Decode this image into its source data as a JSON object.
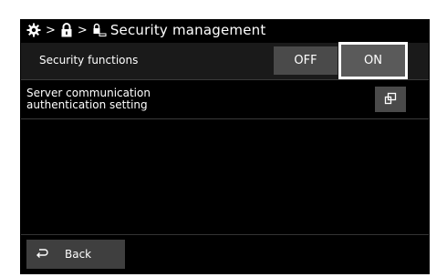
{
  "header": {
    "icons": [
      "gear-icon",
      "lock-icon",
      "lock-key-icon"
    ],
    "separator": ">",
    "title": "Security management"
  },
  "security_functions": {
    "label": "Security functions",
    "off_label": "OFF",
    "on_label": "ON",
    "selected": "ON"
  },
  "server_auth": {
    "label_line1": "Server communication",
    "label_line2": "authentication setting",
    "button_icon": "open-window-icon"
  },
  "footer": {
    "back_label": "Back",
    "back_icon": "return-arrow-icon"
  }
}
